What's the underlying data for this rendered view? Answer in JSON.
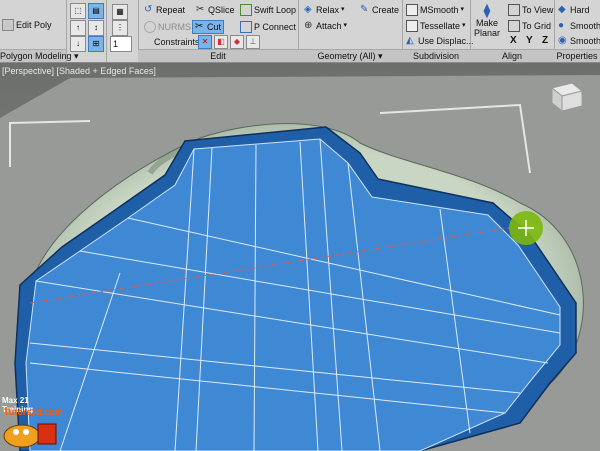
{
  "ribbon": {
    "col1": {
      "edit_poly": "Edit Poly",
      "group_label": "Polygon Modeling ▾"
    },
    "col3": {
      "spinner_value": "1"
    },
    "edit": {
      "repeat": "Repeat",
      "qslice": "QSlice",
      "swift_loop": "Swift Loop",
      "nurms": "NURMS",
      "cut": "Cut",
      "p_connect": "P Connect",
      "constraints": "Constraints:",
      "group_label": "Edit"
    },
    "geometry": {
      "relax": "Relax",
      "create": "Create",
      "attach": "Attach",
      "group_label": "Geometry (All) ▾"
    },
    "subdivision": {
      "msmooth": "MSmooth",
      "tessellate": "Tessellate",
      "use_displace": "Use Displac...",
      "group_label": "Subdivision"
    },
    "align": {
      "make_planar_1": "Make",
      "make_planar_2": "Planar",
      "to_view": "To View",
      "to_grid": "To Grid",
      "x": "X",
      "y": "Y",
      "z": "Z",
      "group_label": "Align"
    },
    "properties": {
      "hard": "Hard",
      "smooth": "Smooth",
      "smooth2": "Smooth",
      "group_label": "Properties"
    }
  },
  "viewport": {
    "label": "[Perspective] [Shaded + Edged Faces]"
  },
  "watermark": {
    "line1": "Max 21 Training",
    "line2": "Tutors3d.com"
  },
  "colors": {
    "ribbon_bg": "#d4d4d4",
    "active_button": "#7ab4e8",
    "mesh_face": "#3f88d4",
    "mesh_edge": "#0f2f5c",
    "cursor_highlight": "#7cb80c"
  }
}
